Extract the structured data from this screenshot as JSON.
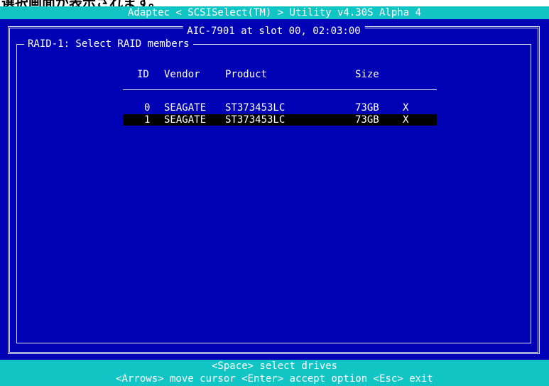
{
  "caption_clip": "選択画面が表示されます。",
  "title_bar": "Adaptec < SCSISelect(TM) > Utility v4.30S Alpha 4",
  "adapter": "AIC-7901   at slot 00, 02:03:00",
  "panel_title": "RAID-1: Select RAID members",
  "columns": {
    "id": "ID",
    "vendor": "Vendor",
    "product": "Product",
    "size": "Size"
  },
  "drives": [
    {
      "id": "0",
      "vendor": "SEAGATE",
      "product": "ST373453LC",
      "size": "73GB",
      "mark": "X"
    },
    {
      "id": "1",
      "vendor": "SEAGATE",
      "product": "ST373453LC",
      "size": "73GB",
      "mark": "X"
    }
  ],
  "selected_row": 1,
  "footer": {
    "line1": "<Space> select drives",
    "line2": "<Arrows> move cursor  <Enter> accept option  <Esc> exit"
  },
  "colors": {
    "background_blue": "#0000b4",
    "bar_cyan": "#11c5c5",
    "text_white": "#ffffff",
    "highlight_black": "#000000"
  }
}
